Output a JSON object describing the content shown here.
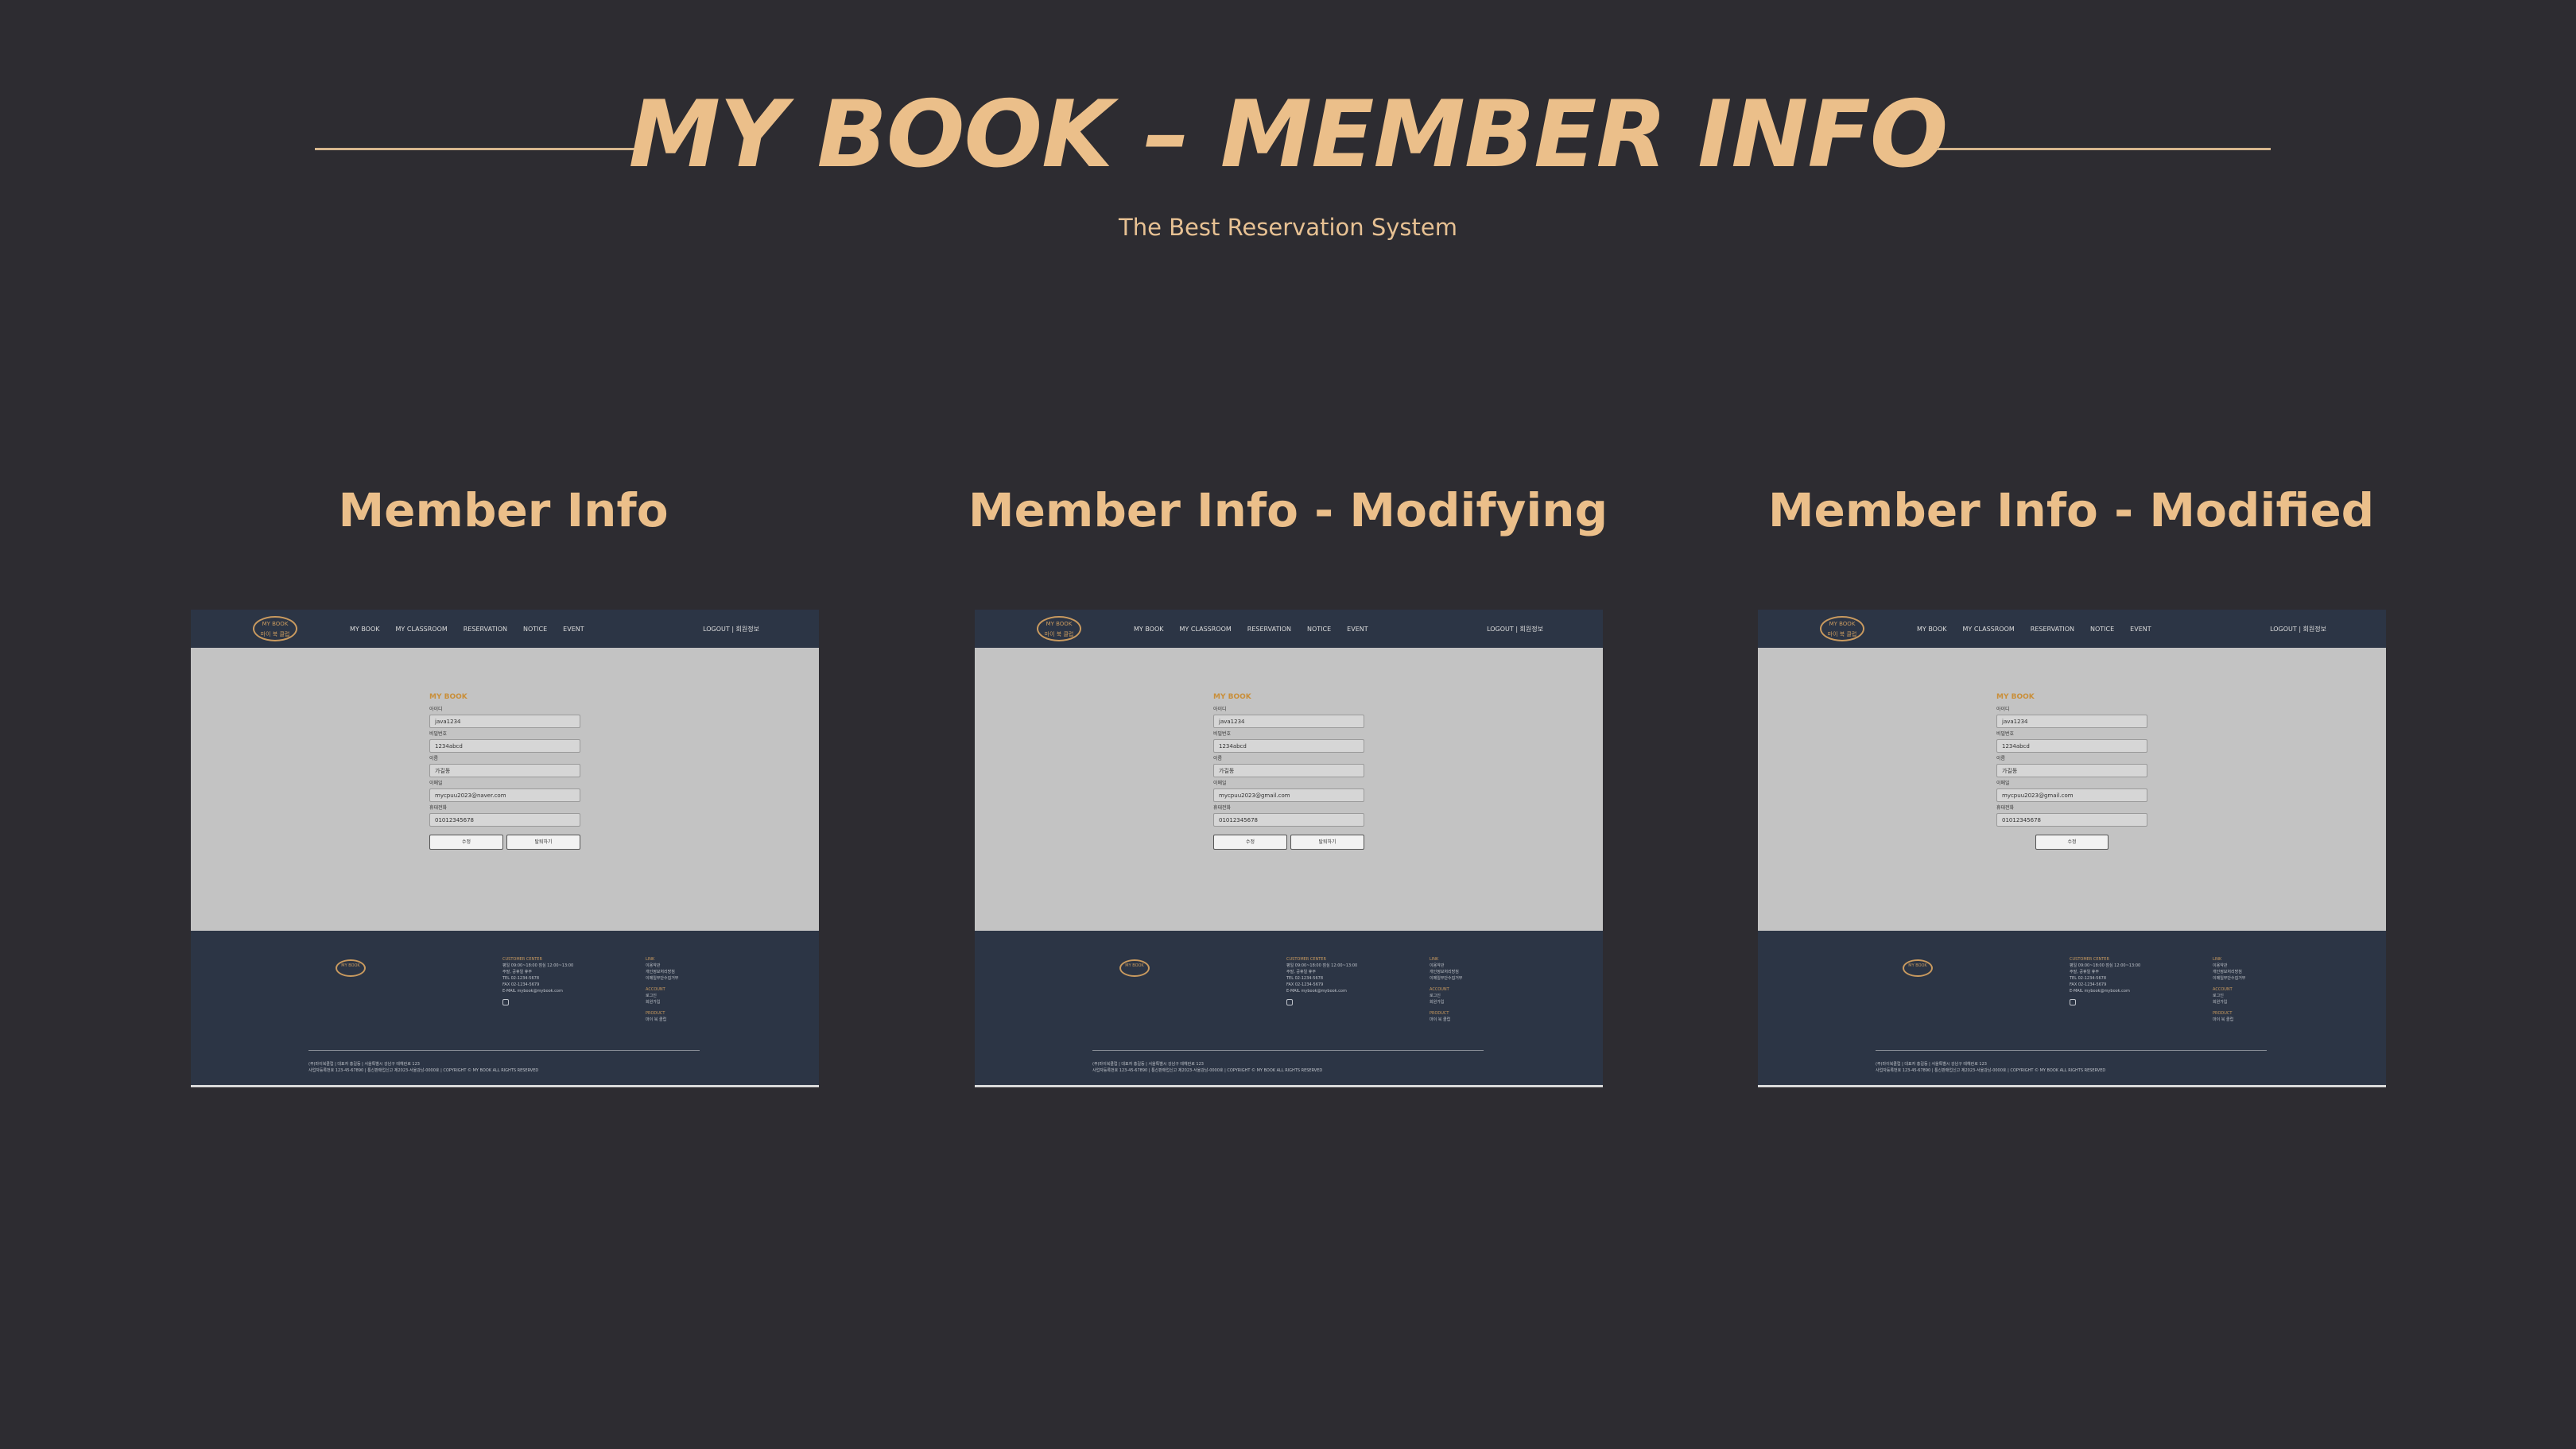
{
  "header": {
    "title": "MY BOOK – MEMBER INFO",
    "subtitle": "The Best Reservation System"
  },
  "site": {
    "logo_top": "MY BOOK",
    "logo_bottom": "마이 북 클럽",
    "nav": [
      "MY BOOK",
      "MY CLASSROOM",
      "RESERVATION",
      "NOTICE",
      "EVENT"
    ],
    "nav_right": "LOGOUT  |  회원정보",
    "form_title": "MY BOOK",
    "labels": [
      "아이디",
      "비밀번호",
      "이름",
      "이메일",
      "휴대전화"
    ],
    "footer": {
      "center_head": "CUSTOMER CENTER",
      "center_lines": [
        "평일 09:00~18:00 점심 12:00~13:00",
        "주말, 공휴일 휴무",
        "TEL 02-1234-5678",
        "FAX 02-1234-5679",
        "E-MAIL mybook@mybook.com"
      ],
      "link_head": "LINK",
      "link_lines": [
        "이용약관",
        "개인정보처리방침",
        "이메일무단수집거부"
      ],
      "account_head": "ACCOUNT",
      "account_lines": [
        "로그인",
        "회원가입"
      ],
      "product_head": "PRODUCT",
      "product_lines": [
        "마이 북 클럽"
      ],
      "copyright": "(주)마이북클럽  |  대표자 홍길동  |  서울특별시 강남구 테헤란로 123",
      "copyright2": "사업자등록번호 123-45-67890  |  통신판매업신고 제2023-서울강남-0000호  |  COPYRIGHT © MY BOOK ALL RIGHTS RESERVED"
    }
  },
  "panels": [
    {
      "title": "Member Info",
      "values": [
        "java1234",
        "1234abcd",
        "가길동",
        "mycpuu2023@naver.com",
        "01012345678"
      ],
      "buttons": [
        "수정",
        "탈퇴하기"
      ]
    },
    {
      "title": "Member Info - Modifying",
      "values": [
        "java1234",
        "1234abcd",
        "가길동",
        "mycpuu2023@gmail.com",
        "01012345678"
      ],
      "buttons": [
        "수정",
        "탈퇴하기"
      ]
    },
    {
      "title": "Member Info - Modified",
      "values": [
        "java1234",
        "1234abcd",
        "가길동",
        "mycpuu2023@gmail.com",
        "01012345678"
      ],
      "buttons": [
        "수정"
      ]
    }
  ]
}
